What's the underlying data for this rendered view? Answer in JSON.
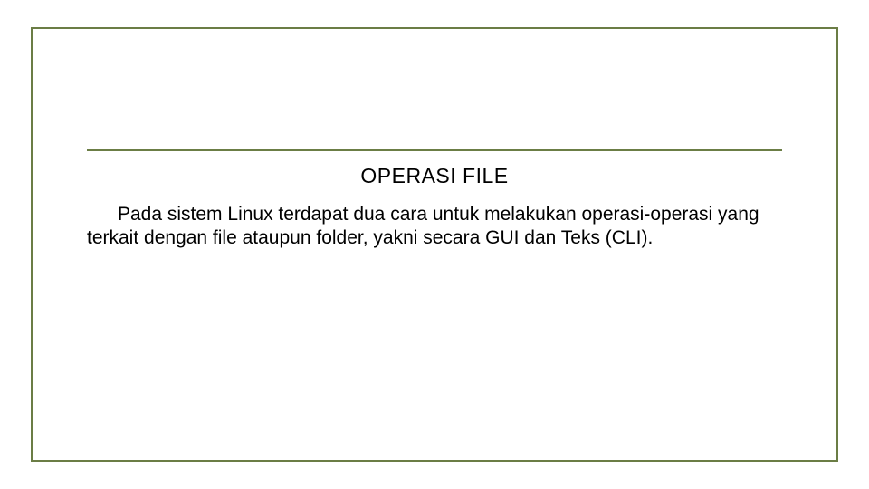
{
  "slide": {
    "title": "OPERASI FILE",
    "body": "Pada sistem Linux terdapat dua cara untuk melakukan operasi-operasi yang terkait dengan file ataupun folder, yakni secara GUI dan Teks (CLI)."
  }
}
